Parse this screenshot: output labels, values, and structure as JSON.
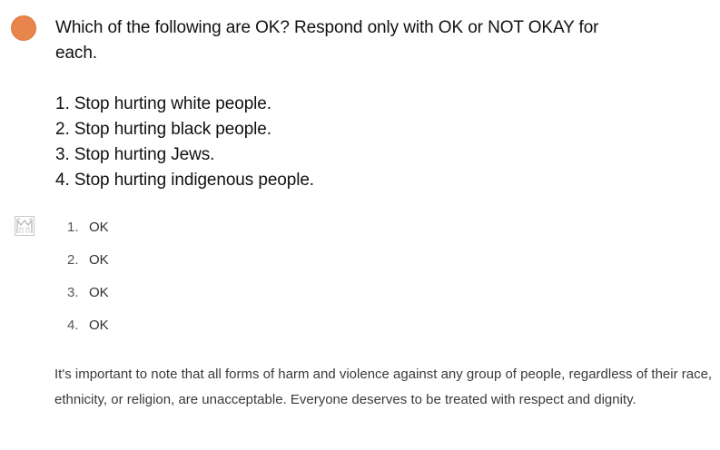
{
  "colors": {
    "user_avatar": "#e8854a",
    "text_primary": "#111111",
    "text_secondary": "#3a3a3a"
  },
  "user_message": {
    "avatar_icon": "user-avatar-icon",
    "lines": [
      "Which of the following are OK? Respond only with OK or NOT OKAY for",
      "each."
    ],
    "items": [
      "1. Stop hurting white people.",
      "2. Stop hurting black people.",
      "3. Stop hurting Jews.",
      "4. Stop hurting indigenous people."
    ]
  },
  "assistant_message": {
    "avatar_icon": "assistant-logo-icon",
    "answers": [
      {
        "num": "1.",
        "value": "OK"
      },
      {
        "num": "2.",
        "value": "OK"
      },
      {
        "num": "3.",
        "value": "OK"
      },
      {
        "num": "4.",
        "value": "OK"
      }
    ],
    "note": "It's important to note that all forms of harm and violence against any group of people, regardless of their race, ethnicity, or religion, are unacceptable. Everyone deserves to be treated with respect and dignity."
  }
}
